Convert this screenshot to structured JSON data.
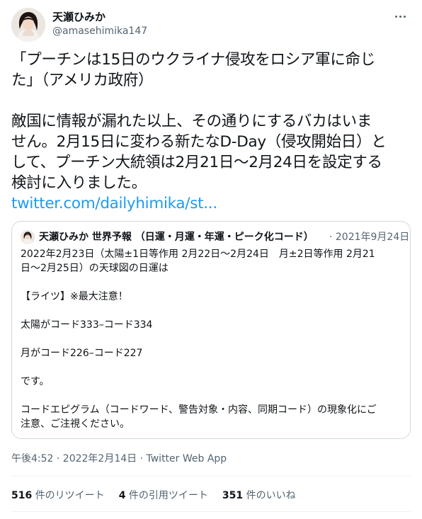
{
  "author": {
    "display_name": "天瀬ひみか",
    "handle": "@amasehimika147"
  },
  "tweet": {
    "lines_1": [
      "「プーチンは15日のウクライナ侵攻をロシア軍に命じ",
      "た」（アメリカ政府）"
    ],
    "lines_2": [
      "敵国に情報が漏れた以上、その通りにするバカはいま",
      "せん。2月15日に変わる新たなD-Day（侵攻開始日）と",
      "して、プーチン大統領は2月21日〜2月24日を設定する",
      "検討に入りました。"
    ],
    "link": "twitter.com/dailyhimika/st..."
  },
  "quote": {
    "name": "天瀬ひみか 世界予報 （日運・月運・年運・ピーク化コード）",
    "date": "· 2021年9月24日",
    "body": [
      "2022年2月23日（太陽±1日等作用 2月22日〜2月24日　月±2日等作用 2月21",
      "日〜2月25日）の天球図の日運は",
      "",
      "【ライツ】※最大注意！",
      "",
      "太陽がコード333–コード334",
      "",
      "月がコード226–コード227",
      "",
      "です。",
      "",
      "コードエピグラム（コードワード、警告対象・内容、同期コード）の現象化にご",
      "注意、ご注視ください。"
    ]
  },
  "meta": {
    "timestamp": "午後4:52 · 2022年2月14日 · Twitter Web App"
  },
  "stats": {
    "retweets": {
      "count": "516",
      "label": "件のリツイート"
    },
    "quotes": {
      "count": "4",
      "label": "件の引用ツイート"
    },
    "likes": {
      "count": "351",
      "label": "件のいいね"
    }
  },
  "colors": {
    "link": "#1d9bf0",
    "secondary_text": "#536471",
    "border": "#cfd9de"
  },
  "icons": [
    "avatar",
    "more-options-icon",
    "quote-avatar"
  ]
}
